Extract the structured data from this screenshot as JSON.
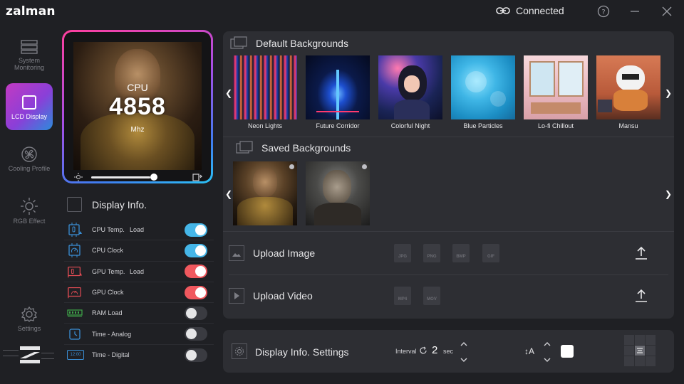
{
  "app": {
    "logo": "zalman"
  },
  "titlebar": {
    "status": "Connected",
    "icons": [
      "link-icon",
      "help-icon",
      "minimize-icon",
      "close-icon"
    ]
  },
  "nav": {
    "items": [
      {
        "id": "system",
        "label": "System Monitoring",
        "icon": "monitor-icon",
        "active": false
      },
      {
        "id": "lcd",
        "label": "LCD Display",
        "icon": "square-icon",
        "active": true
      },
      {
        "id": "cooling",
        "label": "Cooling Profile",
        "icon": "fan-icon",
        "active": false
      },
      {
        "id": "rgb",
        "label": "RGB Effect",
        "icon": "sun-icon",
        "active": false
      },
      {
        "id": "settings",
        "label": "Settings",
        "icon": "gear-icon",
        "active": false
      }
    ]
  },
  "preview": {
    "label": "CPU",
    "value": "4858",
    "unit": "Mhz",
    "brightness": 0.8
  },
  "display_info": {
    "title": "Display Info.",
    "items": [
      {
        "label": "CPU Temp.",
        "extra": "Load",
        "icon": "cpu-temp-icon",
        "on": true,
        "color": "#45b6e8"
      },
      {
        "label": "CPU Clock",
        "extra": "",
        "icon": "cpu-clock-icon",
        "on": true,
        "color": "#45b6e8"
      },
      {
        "label": "GPU Temp.",
        "extra": "Load",
        "icon": "gpu-temp-icon",
        "on": true,
        "color": "#f0585e"
      },
      {
        "label": "GPU Clock",
        "extra": "",
        "icon": "gpu-clock-icon",
        "on": true,
        "color": "#f0585e"
      },
      {
        "label": "RAM Load",
        "extra": "",
        "icon": "ram-icon",
        "on": false,
        "color": "#3a3b41"
      },
      {
        "label": "Time - Analog",
        "extra": "",
        "icon": "clock-icon",
        "on": false,
        "color": "#3a3b41"
      },
      {
        "label": "Time - Digital",
        "extra": "",
        "icon": "digital-clock-icon",
        "on": false,
        "color": "#3a3b41"
      }
    ],
    "digital_icon_text": "12:00"
  },
  "default_backgrounds": {
    "title": "Default Backgrounds",
    "items": [
      "Neon Lights",
      "Future Corridor",
      "Colorful Night",
      "Blue Particles",
      "Lo-fi Chillout",
      "Mansu"
    ]
  },
  "saved_backgrounds": {
    "title": "Saved Backgrounds"
  },
  "upload": {
    "image": {
      "label": "Upload Image",
      "formats": [
        "JPG",
        "PNG",
        "BMP",
        "GIF"
      ]
    },
    "video": {
      "label": "Upload Video",
      "formats": [
        "MP4",
        "MOV"
      ]
    }
  },
  "settings_bar": {
    "title": "Display Info. Settings",
    "interval_label": "Interval",
    "interval_value": "2",
    "interval_unit": "sec",
    "font_size_icon": "↕A",
    "text_color": "#ffffff"
  }
}
